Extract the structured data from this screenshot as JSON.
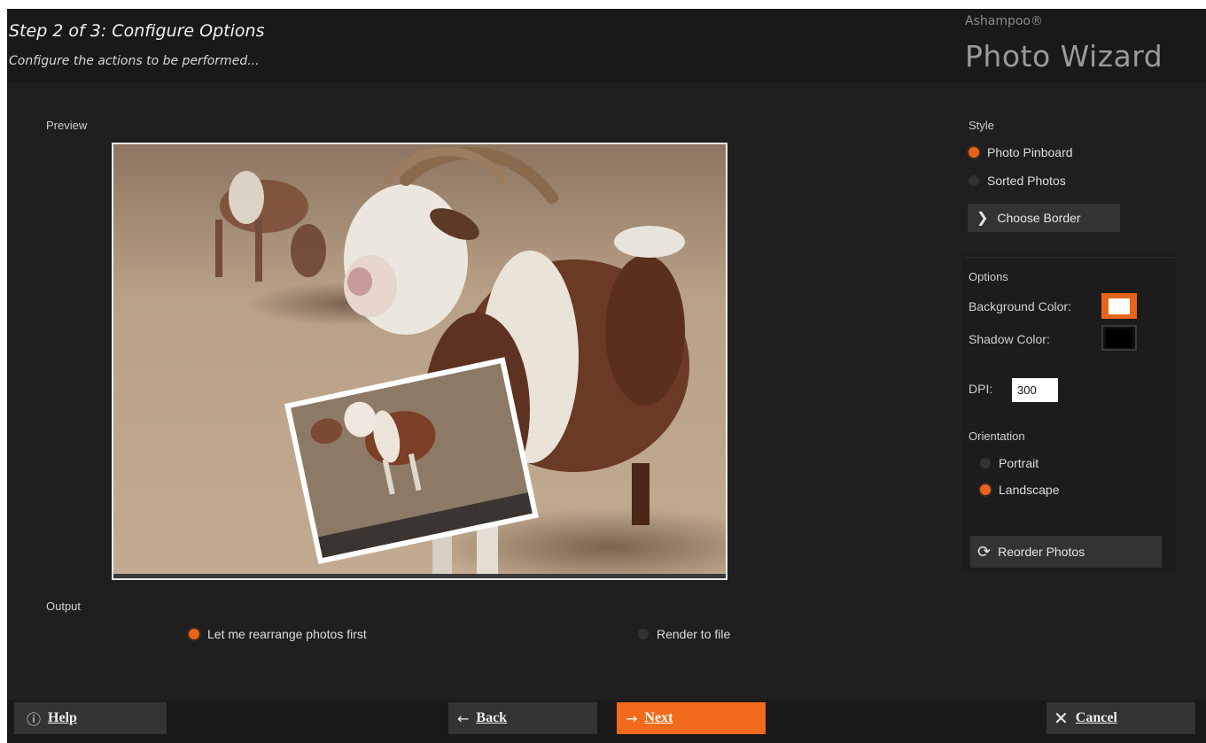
{
  "header": {
    "step_title": "Step 2 of 3: Configure Options",
    "step_subtitle": "Configure the actions to be performed...",
    "brand_small": "Ashampoo®",
    "brand_big": "Photo Wizard"
  },
  "preview": {
    "label": "Preview"
  },
  "output": {
    "label": "Output",
    "options": [
      {
        "label": "Let me rearrange photos first",
        "selected": true
      },
      {
        "label": "Render to file",
        "selected": false
      }
    ]
  },
  "style": {
    "label": "Style",
    "options": [
      {
        "label": "Photo Pinboard",
        "selected": true
      },
      {
        "label": "Sorted Photos",
        "selected": false
      }
    ],
    "choose_border": "Choose Border"
  },
  "options": {
    "label": "Options",
    "background_color_label": "Background Color:",
    "background_color": "#ffffff",
    "shadow_color_label": "Shadow Color:",
    "shadow_color": "#000000",
    "dpi_label": "DPI:",
    "dpi_value": "300",
    "orientation_label": "Orientation",
    "orientation": [
      {
        "label": "Portrait",
        "selected": false
      },
      {
        "label": "Landscape",
        "selected": true
      }
    ],
    "reorder_photos": "Reorder Photos"
  },
  "footer": {
    "help": "Help",
    "back": "Back",
    "next": "Next",
    "cancel": "Cancel"
  },
  "colors": {
    "accent": "#e8641a",
    "background": "#1f1f1f",
    "button": "#333333"
  },
  "icons": {
    "help": "help-circle-icon",
    "back": "arrow-left-icon",
    "next": "arrow-right-icon",
    "cancel": "close-icon",
    "choose_border": "chevron-right-icon",
    "reorder": "refresh-icon"
  }
}
